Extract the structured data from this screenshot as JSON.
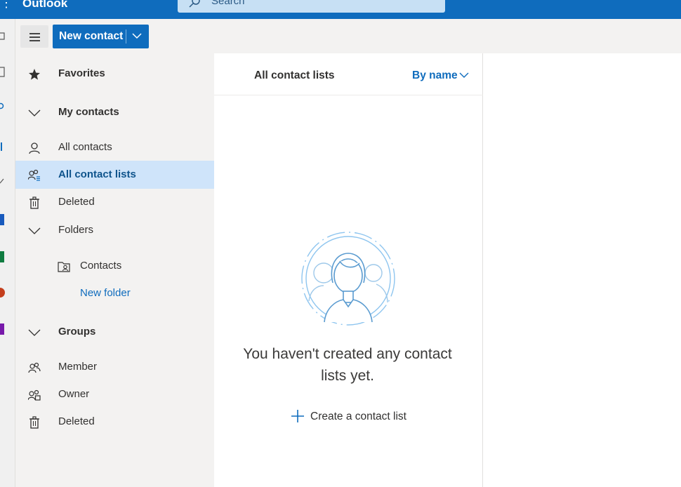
{
  "header": {
    "app_title": "Outlook",
    "search_placeholder": "Search"
  },
  "command_bar": {
    "new_contact_label": "New contact"
  },
  "nav": {
    "favorites": "Favorites",
    "my_contacts": "My contacts",
    "all_contacts": "All contacts",
    "all_contact_lists": "All contact lists",
    "deleted": "Deleted",
    "folders": "Folders",
    "contacts_folder": "Contacts",
    "new_folder": "New folder",
    "groups": "Groups",
    "member": "Member",
    "owner": "Owner",
    "groups_deleted": "Deleted",
    "selected": "All contact lists"
  },
  "list_pane": {
    "title": "All contact lists",
    "sort_label": "By name",
    "empty_message": "You haven't created any contact lists yet.",
    "create_label": "Create a contact list"
  },
  "colors": {
    "brand": "#0f6cbd",
    "selected_bg": "#cfe4fa",
    "nav_bg": "#f3f2f1"
  },
  "icons": {
    "search": "search-icon",
    "menu": "hamburger-icon",
    "favorites": "star-icon",
    "expand": "chevron-down-icon",
    "contact": "person-icon",
    "list": "people-list-icon",
    "delete": "trash-icon",
    "folder": "folder-person-icon",
    "member": "people-icon",
    "owner": "people-owner-icon",
    "add": "plus-icon"
  }
}
